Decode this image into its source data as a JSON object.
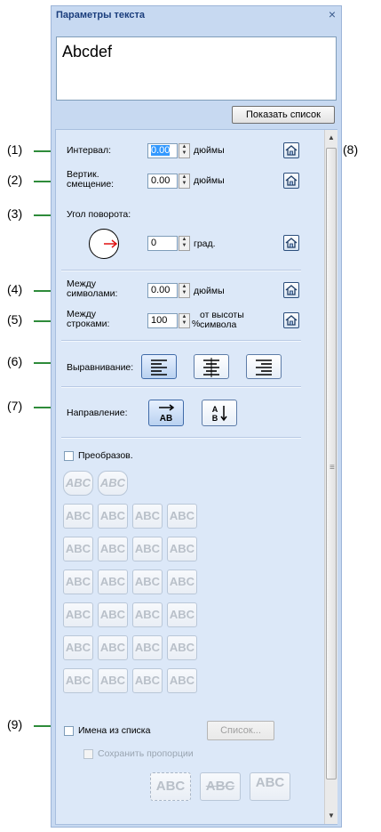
{
  "panel": {
    "title": "Параметры текста",
    "close": "×",
    "preview_text": "Abcdef",
    "show_list_label": "Показать список"
  },
  "callouts": [
    "(1)",
    "(2)",
    "(3)",
    "(4)",
    "(5)",
    "(6)",
    "(7)",
    "(8)",
    "(9)"
  ],
  "spacing": {
    "label": "Интервал:",
    "value": "0.00",
    "unit": "дюймы"
  },
  "vertical": {
    "label1": "Вертик.",
    "label2": "смещение:",
    "value": "0.00",
    "unit": "дюймы"
  },
  "rotation": {
    "label": "Угол поворота:",
    "value": "0",
    "unit": "град."
  },
  "char_spacing": {
    "label1": "Между",
    "label2": "символами:",
    "value": "0.00",
    "unit": "дюймы"
  },
  "line_spacing": {
    "label1": "Между",
    "label2": "строками:",
    "value": "100",
    "unit_pct": "%",
    "unit1": "от высоты",
    "unit2": "символа"
  },
  "alignment": {
    "label": "Выравнивание:"
  },
  "direction": {
    "label": "Направление:"
  },
  "transform": {
    "label": "Преобразов.",
    "sample": "ABC"
  },
  "names": {
    "label": "Имена из списка",
    "list_button": "Список...",
    "keep_ratio": "Сохранить пропорции",
    "sample": "ABC"
  },
  "colors": {
    "panel_bg": "#c7d9f1",
    "title": "#1a3d7c",
    "callout_line": "#2e8b3a"
  }
}
